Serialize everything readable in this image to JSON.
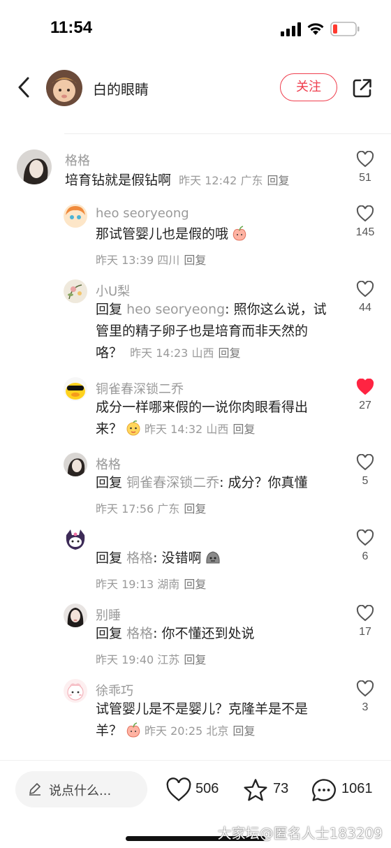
{
  "status_bar": {
    "time": "11:54"
  },
  "header": {
    "author_name": "白的眼睛",
    "follow_label": "关注"
  },
  "comments": [
    {
      "user": "格格",
      "text": "培育钻就是假钻啊",
      "time": "昨天 12:42",
      "location": "广东",
      "reply_label": "回复",
      "likes": "51"
    },
    {
      "user": "heo seoryeong",
      "text": "那试管婴儿也是假的哦",
      "time": "昨天 13:39",
      "location": "四川",
      "reply_label": "回复",
      "likes": "145",
      "emoji": "peach-sticker-icon"
    },
    {
      "user": "小U梨",
      "reply_prefix": "回复",
      "reply_to": "heo seoryeong",
      "text": ": 照你这么说，试管里的精子卵子也是培育而非天然的咯？",
      "time": "昨天 14:23",
      "location": "山西",
      "reply_label": "回复",
      "likes": "44"
    },
    {
      "user": "铜雀春深锁二乔",
      "text": "成分一样哪来假的一说你肉眼看得出来？",
      "time": "昨天 14:32",
      "location": "山西",
      "reply_label": "回复",
      "likes": "27",
      "liked": true,
      "emoji": "peach-face-sticker-icon"
    },
    {
      "user": "格格",
      "reply_prefix": "回复",
      "reply_to": "铜雀春深锁二乔",
      "text": ": 成分？你真懂",
      "time": "昨天 17:56",
      "location": "广东",
      "reply_label": "回复",
      "likes": "5"
    },
    {
      "user": "",
      "reply_prefix": "回复",
      "reply_to": "格格",
      "text": ": 没错啊",
      "time": "昨天 19:13",
      "location": "湖南",
      "reply_label": "回复",
      "likes": "6",
      "emoji": "gray-blob-sticker-icon"
    },
    {
      "user": "别睡",
      "reply_prefix": "回复",
      "reply_to": "格格",
      "text": ": 你不懂还到处说",
      "time": "昨天 19:40",
      "location": "江苏",
      "reply_label": "回复",
      "likes": "17"
    },
    {
      "user": "徐乖巧",
      "text": "试管婴儿是不是婴儿？克隆羊是不是羊？",
      "time": "昨天 20:25",
      "location": "北京",
      "reply_label": "回复",
      "likes": "3",
      "emoji": "peach-sticker-icon"
    }
  ],
  "bottom_bar": {
    "input_placeholder": "说点什么...",
    "likes": "506",
    "favorites": "73",
    "comments": "1061"
  },
  "watermark": "大家坛@匿名人士183209",
  "colors": {
    "accent": "#ef3d4d",
    "muted": "#9a9a9a",
    "liked": "#ff2442"
  }
}
